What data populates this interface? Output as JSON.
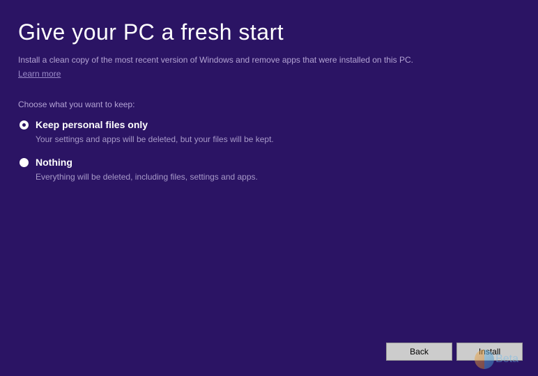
{
  "header": {
    "title": "Give your PC a fresh start",
    "subtitle": "Install a clean copy of the most recent version of Windows and remove apps that were installed on this PC.",
    "learn_more": "Learn more"
  },
  "prompt": "Choose what you want to keep:",
  "options": [
    {
      "label": "Keep personal files only",
      "description": "Your settings and apps will be deleted, but your files will be kept.",
      "selected": true
    },
    {
      "label": "Nothing",
      "description": "Everything will be deleted, including files, settings and apps.",
      "selected": false
    }
  ],
  "buttons": {
    "back": "Back",
    "install": "Install"
  },
  "watermark": {
    "text": "Beta"
  }
}
